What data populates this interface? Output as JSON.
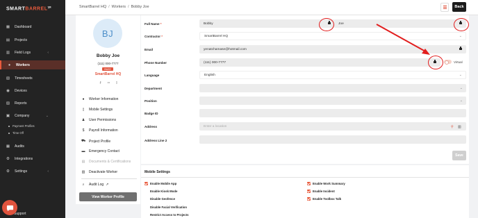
{
  "app": {
    "logo_main": "SMART",
    "logo_accent": "BARREL",
    "logo_tm": "TM"
  },
  "sidebar": {
    "items": [
      {
        "label": "Dashboard",
        "icon": "dashboard-icon"
      },
      {
        "label": "Projects",
        "icon": "projects-icon"
      },
      {
        "label": "Field Logs",
        "icon": "field-logs-icon",
        "chevron": "‹"
      },
      {
        "label": "Workers",
        "icon": "workers-icon",
        "active": true
      },
      {
        "label": "Timesheets",
        "icon": "timesheets-icon"
      },
      {
        "label": "Devices",
        "icon": "devices-icon"
      },
      {
        "label": "Reports",
        "icon": "reports-icon"
      },
      {
        "label": "Company",
        "icon": "company-icon",
        "chevron": "⌄"
      },
      {
        "label": "Audits",
        "icon": "audits-icon"
      },
      {
        "label": "Integrations",
        "icon": "integrations-icon"
      },
      {
        "label": "Settings",
        "icon": "settings-icon",
        "chevron": "‹"
      }
    ],
    "sub_items": [
      {
        "label": "Payment Profiles"
      },
      {
        "label": "Time Off"
      }
    ],
    "support_label": "Support"
  },
  "topbar": {
    "breadcrumb": [
      "SmartBarrel HQ",
      "Workers",
      "Bobby Joe"
    ],
    "separator": "/",
    "back_label": "Back"
  },
  "profile": {
    "initials": "BJ",
    "name": "Bobby Joe",
    "phone": "(111) 000-7777",
    "badge": "BUZZ",
    "company": "SmartBarrel HQ",
    "menu": [
      {
        "label": "Worker Information",
        "icon": "person-icon"
      },
      {
        "label": "Mobile Settings",
        "icon": "phone-icon"
      },
      {
        "label": "User Permissions",
        "icon": "user-lock-icon"
      },
      {
        "label": "Payroll Information",
        "icon": "dollar-icon"
      },
      {
        "label": "Project Profile",
        "icon": "truck-icon"
      },
      {
        "label": "Emergency Contact",
        "icon": "id-card-icon"
      },
      {
        "label": "Documents & Certifications",
        "icon": "document-icon",
        "disabled": true
      },
      {
        "label": "Deactivate Worker",
        "icon": "trash-icon"
      },
      {
        "label": "Audit Log",
        "icon": "search-icon",
        "external": "↗"
      }
    ],
    "view_button": "View Worker Profile"
  },
  "form": {
    "labels": {
      "full_name": "Full Name",
      "contractor": "Contractor",
      "email": "Email",
      "phone": "Phone Number",
      "language": "Language",
      "department": "Department",
      "position": "Position",
      "badge_id": "Badge ID",
      "address": "Address",
      "address2": "Address Line 2"
    },
    "required_mark": "*",
    "values": {
      "first_name": "Bobby",
      "last_name": "Joe",
      "contractor": "SmartBarrel HQ",
      "email": "yenatchamase@hotmail.com",
      "phone": "(111) 000-7777",
      "language": "English",
      "department": "",
      "position": "",
      "badge_id": "",
      "address_placeholder": "Enter a location",
      "address2": ""
    },
    "virtual_label": "Virtual",
    "virtual_on": false,
    "save_label": "Save"
  },
  "mobile_settings": {
    "title": "Mobile Settings",
    "left": [
      {
        "label": "Enable Mobile App",
        "checked": true
      },
      {
        "label": "Enable Kiosk Mode",
        "checked": false
      },
      {
        "label": "Disable Geofence",
        "checked": false
      },
      {
        "label": "Disable Facial Verification",
        "checked": false
      },
      {
        "label": "Restrict Access to Projects",
        "checked": false
      }
    ],
    "right": [
      {
        "label": "Enable Work Summary",
        "checked": true
      },
      {
        "label": "Enable Incident",
        "checked": true
      },
      {
        "label": "Enable Toolbox Talk",
        "checked": true
      }
    ]
  },
  "colors": {
    "accent": "#e85a3c",
    "sidebar": "#232323",
    "annotation": "#e21d1d"
  }
}
